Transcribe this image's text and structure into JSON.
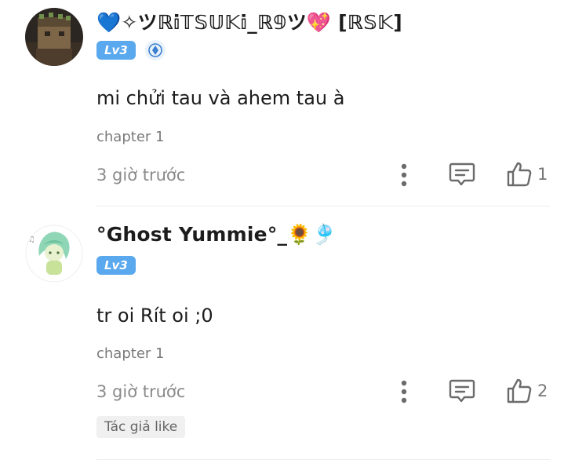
{
  "comments": [
    {
      "username": "💙✧ツℝ𝕚𝕋𝕊𝕌𝕂𝕚_ℝ𝟡ツ💖 [ℝ𝕊𝕂]",
      "level": "Lv3",
      "text": "mi chửi tau và ahem tau à",
      "chapter": "chapter 1",
      "time": "3 giờ trước",
      "likes": "1"
    },
    {
      "username": "°Ghost Yummie°_🌻🎐",
      "level": "Lv3",
      "text": "tr oi Rít oi ;0",
      "chapter": "chapter 1",
      "time": "3 giờ trước",
      "likes": "2",
      "author_like_label": "Tác giả like"
    }
  ],
  "icons": {
    "more": "more-vertical-icon",
    "reply": "comment-icon",
    "like": "thumbs-up-icon",
    "badge": "diamond-badge-icon"
  },
  "colors": {
    "level_badge": "#5aa8ee",
    "icon": "#777777",
    "muted_text": "#8a8a8a"
  }
}
